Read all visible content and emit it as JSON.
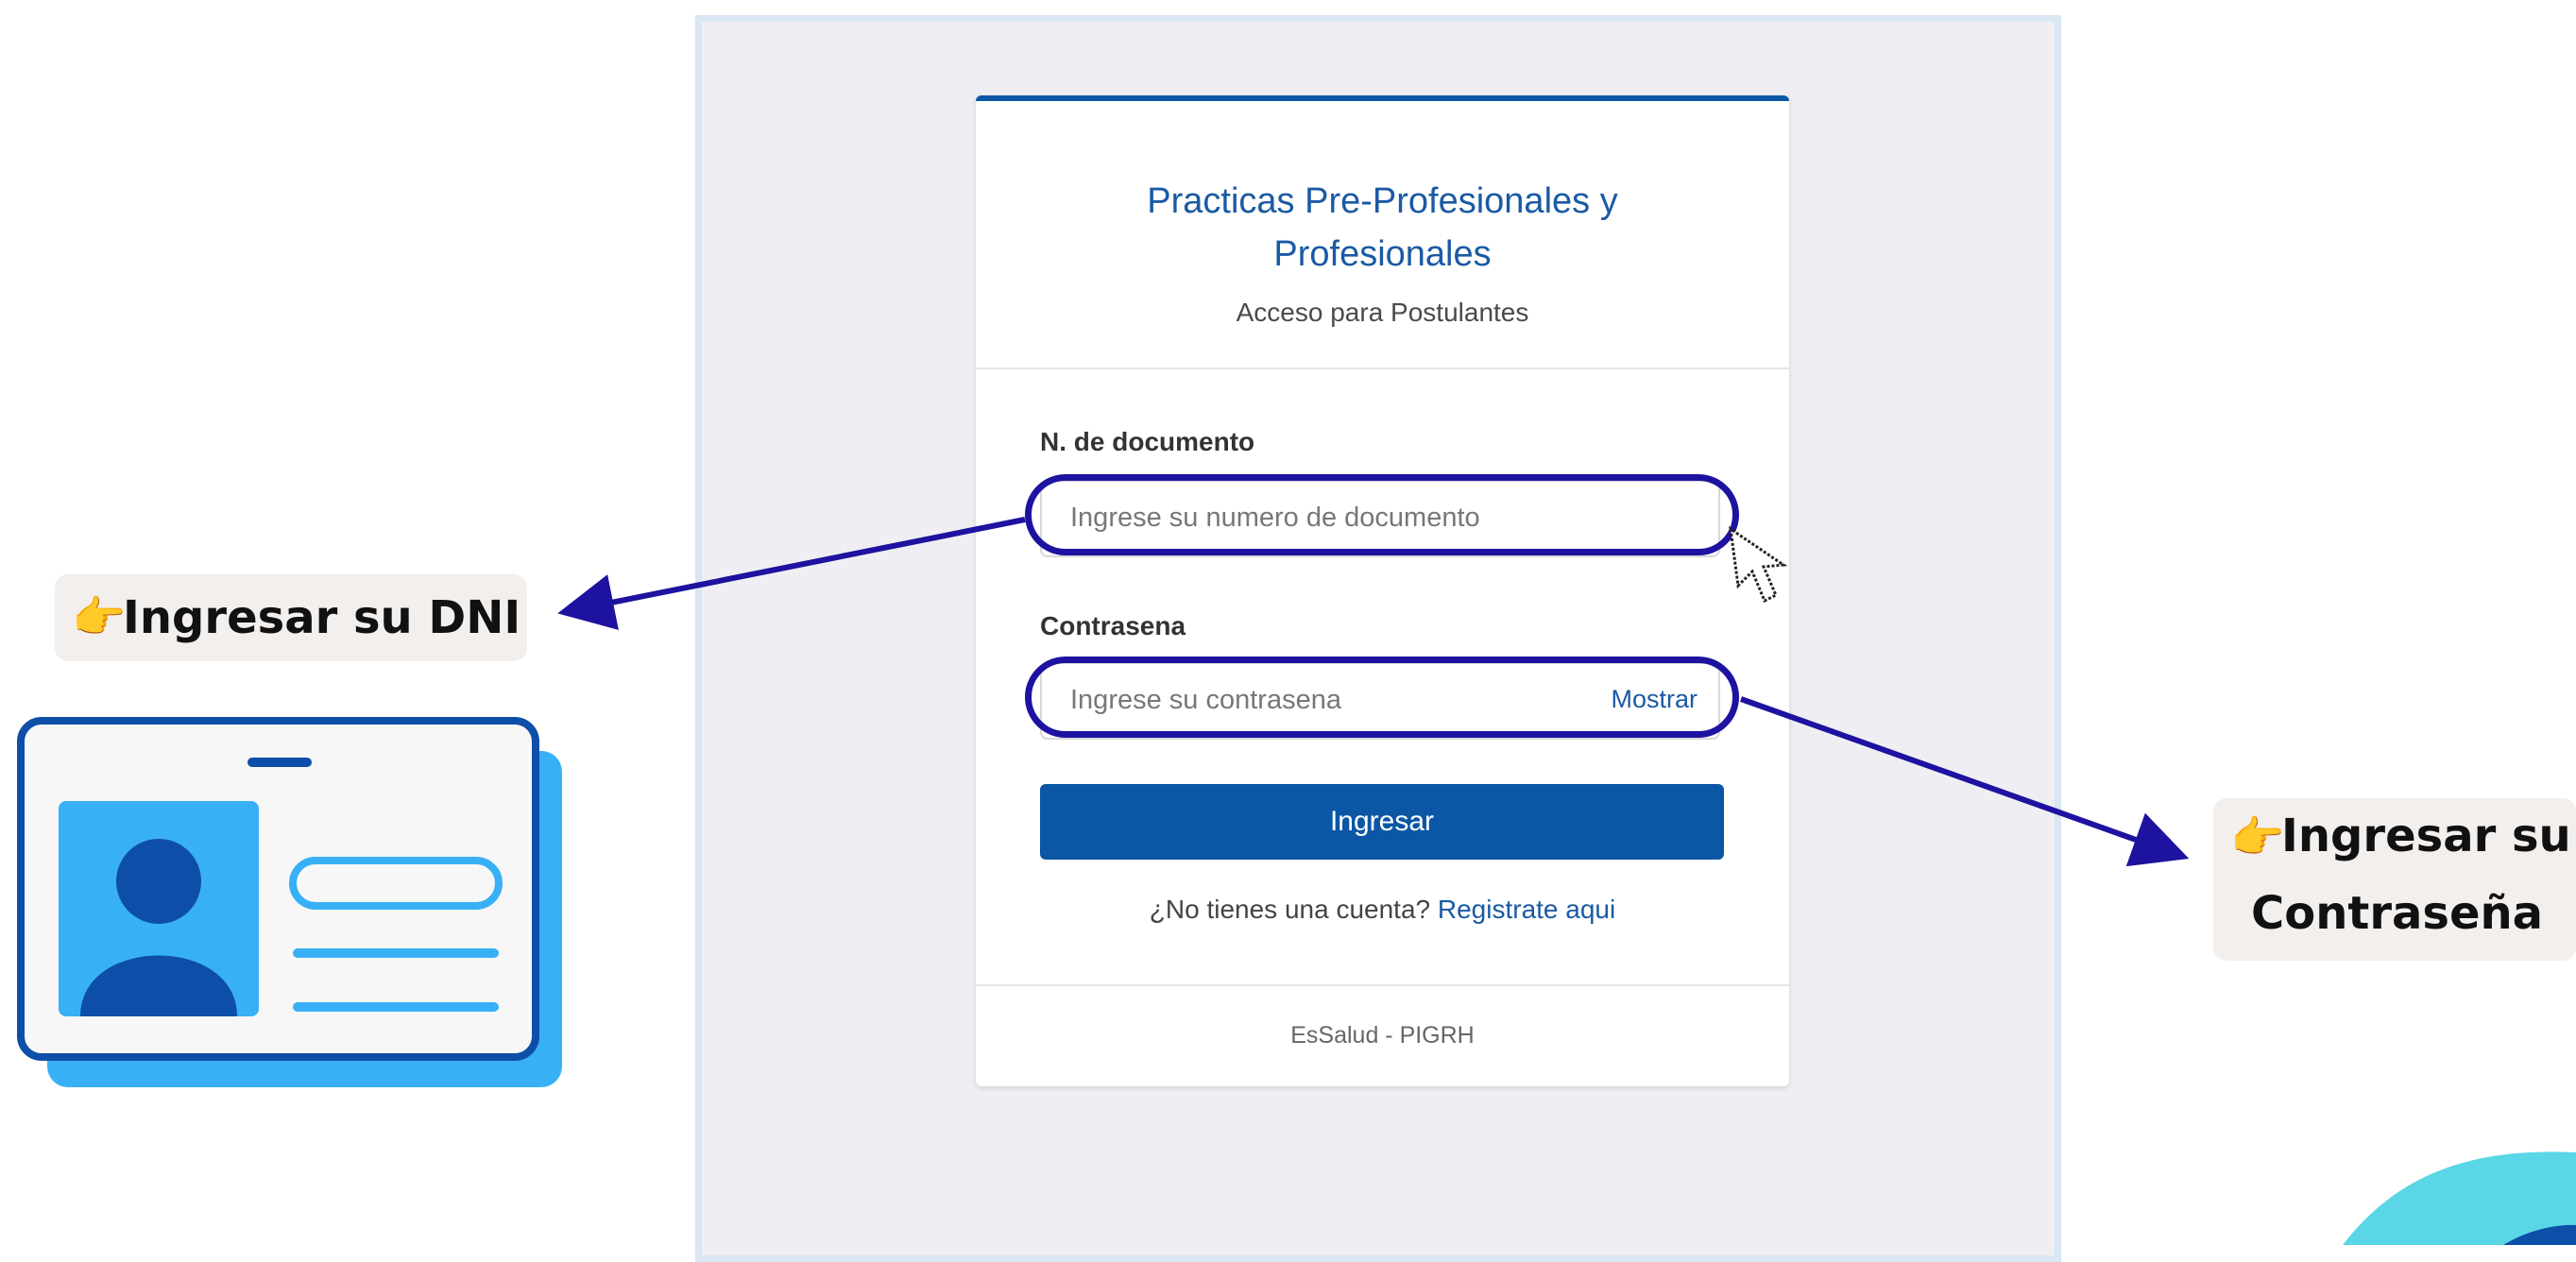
{
  "login": {
    "title": "Practicas Pre-Profesionales y Profesionales",
    "subtitle": "Acceso para Postulantes",
    "document_label": "N. de documento",
    "document_placeholder": "Ingrese su numero de documento",
    "password_label": "Contrasena",
    "password_placeholder": "Ingrese su contrasena",
    "show_password": "Mostrar",
    "submit_label": "Ingresar",
    "no_account_text": "¿No tienes una cuenta?",
    "register_link": "Registrate aqui",
    "footer": "EsSalud - PIGRH"
  },
  "annotations": {
    "dni_callout": "Ingresar su DNI",
    "password_callout_line1": "Ingresar su",
    "password_callout_line2": "Contraseña",
    "hand_icon": "👉"
  },
  "colors": {
    "primary_blue": "#0b57a5",
    "highlight": "#1e12a0",
    "id_card_blue": "#38b0f5",
    "id_card_dark": "#0d4fa8"
  }
}
